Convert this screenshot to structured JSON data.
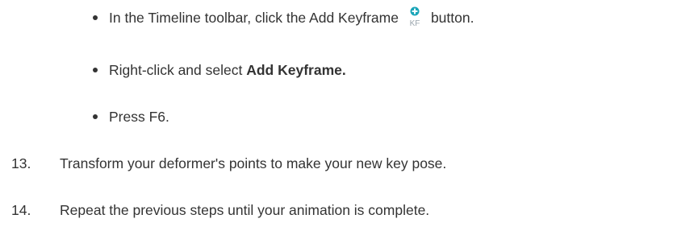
{
  "steps": {
    "bullets": [
      {
        "prefix": "In the Timeline toolbar, click the Add Keyframe",
        "icon": "add-keyframe-icon",
        "suffix": "button."
      },
      {
        "prefix": "Right-click and select ",
        "bold": "Add Keyframe."
      },
      {
        "text": "Press F6."
      }
    ],
    "numbered": [
      {
        "number": "13.",
        "text": "Transform your deformer's points to make your new key pose."
      },
      {
        "number": "14.",
        "text": "Repeat the previous steps until your animation is complete."
      }
    ]
  },
  "colors": {
    "text": "#333333",
    "icon_plus": "#1aa5b8",
    "icon_letters": "#9aa5ad"
  }
}
